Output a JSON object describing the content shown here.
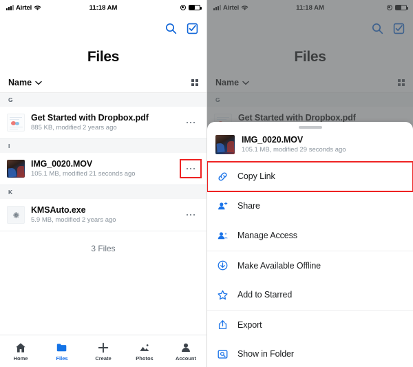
{
  "status_bar": {
    "carrier": "Airtel",
    "time": "11:18 AM",
    "signal_icon": "cellular-bars-icon",
    "wifi_icon": "wifi-icon",
    "lock_icon": "rotation-lock-icon",
    "battery_icon": "battery-icon"
  },
  "nav": {
    "search_icon": "search-icon",
    "select_icon": "select-checkbox-icon"
  },
  "header": {
    "title": "Files"
  },
  "sortbar": {
    "sort_label": "Name",
    "chevron_icon": "chevron-down-icon",
    "grid_icon": "grid-view-icon"
  },
  "accent": {
    "blue": "#0f6be8",
    "link_blue": "#1a73e8",
    "highlight_red": "#ee2222",
    "muted_text": "#8b959e"
  },
  "list": {
    "sections": [
      {
        "letter": "G",
        "files": [
          {
            "name": "Get Started with Dropbox.pdf",
            "meta": "885 KB, modified 2 years ago",
            "thumb": "pdf-document-thumbnail",
            "more_icon": "more-options-icon",
            "highlighted": false
          }
        ]
      },
      {
        "letter": "I",
        "files": [
          {
            "name": "IMG_0020.MOV",
            "meta": "105.1 MB, modified 21 seconds ago",
            "thumb": "video-thumbnail",
            "more_icon": "more-options-icon",
            "highlighted": true
          }
        ]
      },
      {
        "letter": "K",
        "files": [
          {
            "name": "KMSAuto.exe",
            "meta": "5.9 MB, modified 2 years ago",
            "thumb": "executable-gear-thumbnail",
            "more_icon": "more-options-icon",
            "highlighted": false
          }
        ]
      }
    ],
    "file_count": "3 Files"
  },
  "tabbar": {
    "tabs": [
      {
        "label": "Home",
        "icon": "home-icon",
        "active": false
      },
      {
        "label": "Files",
        "icon": "folder-icon",
        "active": true
      },
      {
        "label": "Create",
        "icon": "plus-icon",
        "active": false
      },
      {
        "label": "Photos",
        "icon": "photos-icon",
        "active": false
      },
      {
        "label": "Account",
        "icon": "person-icon",
        "active": false
      }
    ]
  },
  "action_sheet": {
    "handle_icon": "drag-handle-icon",
    "file": {
      "name": "IMG_0020.MOV",
      "meta": "105.1 MB, modified 29 seconds ago",
      "thumb": "video-thumbnail"
    },
    "items": [
      {
        "label": "Copy Link",
        "icon": "link-icon",
        "highlighted": true,
        "divider_top": false
      },
      {
        "label": "Share",
        "icon": "person-add-icon",
        "highlighted": false,
        "divider_top": false
      },
      {
        "label": "Manage Access",
        "icon": "manage-people-icon",
        "highlighted": false,
        "divider_top": false
      },
      {
        "label": "Make Available Offline",
        "icon": "download-circle-icon",
        "highlighted": false,
        "divider_top": true
      },
      {
        "label": "Add to Starred",
        "icon": "star-icon",
        "highlighted": false,
        "divider_top": false
      },
      {
        "label": "Export",
        "icon": "export-share-icon",
        "highlighted": false,
        "divider_top": true
      },
      {
        "label": "Show in Folder",
        "icon": "show-in-folder-icon",
        "highlighted": false,
        "divider_top": false
      }
    ]
  }
}
